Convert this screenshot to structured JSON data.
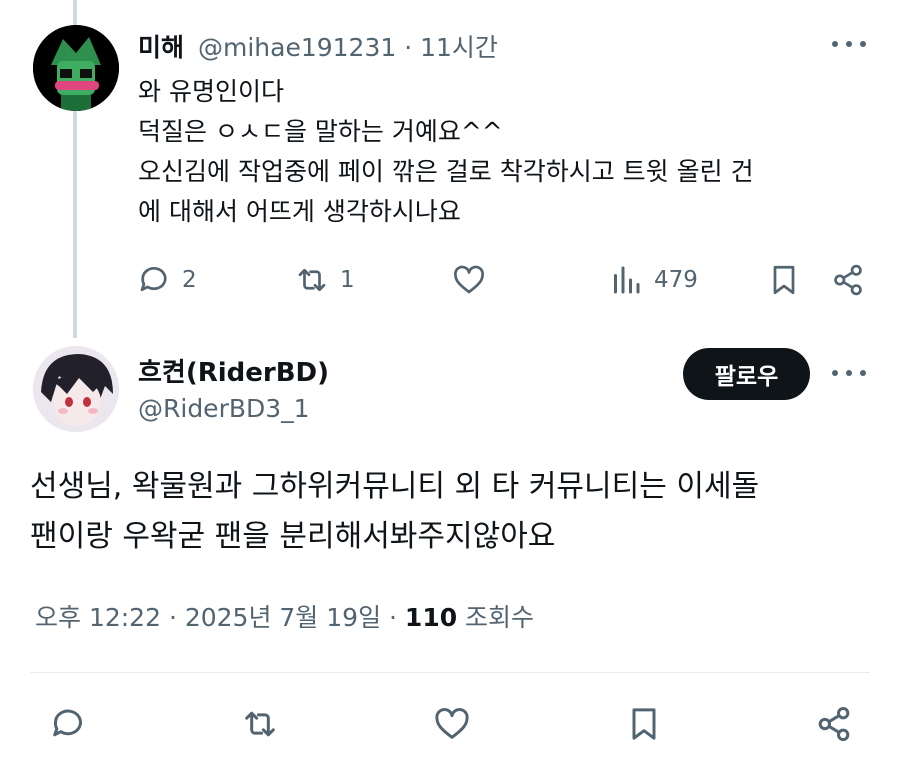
{
  "tweet1": {
    "name": "미해",
    "handle": "@mihae191231 · 11시간",
    "lines": [
      "와 유명인이다",
      "덕질은 ㅇㅅㄷ을 말하는 거예요^^",
      "오신김에 작업중에 페이 깎은 걸로 착각하시고 트윗 올린 건",
      "에 대해서 어뜨게 생각하시나요"
    ],
    "actions": {
      "reply_count": "2",
      "retweet_count": "1",
      "views_count": "479"
    }
  },
  "tweet2": {
    "name": "흐켠(RiderBD)",
    "handle": "@RiderBD3_1",
    "follow_label": "팔로우",
    "lines": [
      "선생님, 왁물원과 그하위커뮤니티 외 타 커뮤니티는 이세돌",
      "팬이랑 우왁굳 팬을 분리해서봐주지않아요"
    ],
    "meta": {
      "time": "오후 12:22 · 2025년 7월 19일 · ",
      "views": "110",
      "views_label": " 조회수"
    }
  },
  "icons": {
    "reply": "reply-icon",
    "retweet": "retweet-icon",
    "like": "heart-icon",
    "views": "views-icon",
    "bookmark": "bookmark-icon",
    "share": "share-icon",
    "more": "more-icon"
  },
  "colors": {
    "text": "#0f1419",
    "secondary": "#536471",
    "thread_line": "#cfd9de",
    "follow_bg": "#0f1419"
  }
}
